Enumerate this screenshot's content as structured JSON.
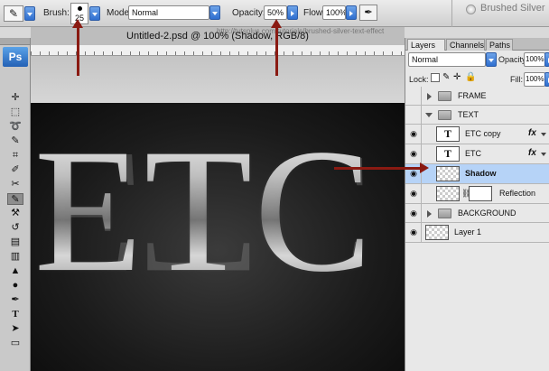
{
  "options_bar": {
    "brush_label": "Brush:",
    "brush_size": "25",
    "mode_label": "Mode:",
    "mode_value": "Normal",
    "opacity_label": "Opacity:",
    "opacity_value": "50%",
    "flow_label": "Flow:",
    "flow_value": "100%",
    "workspace_name": "Brushed Silver"
  },
  "document": {
    "title": "Untitled-2.psd @ 100% (Shadow, RGB/8)",
    "behind_title_text": "http://tutsplus.com/tutorials/brushed-silver-text-effect",
    "canvas_text": "ETC"
  },
  "tools": {
    "logo": "Ps"
  },
  "layers_panel": {
    "tabs": [
      {
        "label": "Layers",
        "close": "×"
      },
      {
        "label": "Channels"
      },
      {
        "label": "Paths"
      }
    ],
    "blend_mode": "Normal",
    "opacity_label": "Opacity:",
    "opacity_value": "100%",
    "lock_label": "Lock:",
    "fill_label": "Fill:",
    "fill_value": "100%",
    "fx_label": "fx",
    "layers": [
      {
        "name": "FRAME",
        "kind": "group",
        "expanded": false
      },
      {
        "name": "TEXT",
        "kind": "group",
        "expanded": true
      },
      {
        "name": "ETC copy",
        "kind": "text",
        "thumb": "T"
      },
      {
        "name": "ETC",
        "kind": "text",
        "thumb": "T"
      },
      {
        "name": "Shadow",
        "kind": "raster",
        "selected": true
      },
      {
        "name": "Reflection",
        "kind": "masked"
      },
      {
        "name": "BACKGROUND",
        "kind": "group",
        "expanded": false
      },
      {
        "name": "Layer 1",
        "kind": "raster"
      }
    ]
  },
  "colors": {
    "accent_blue": "#2f6fd0",
    "selected_row": "#b6d3f7",
    "annotation_arrow": "#8a1a12"
  }
}
